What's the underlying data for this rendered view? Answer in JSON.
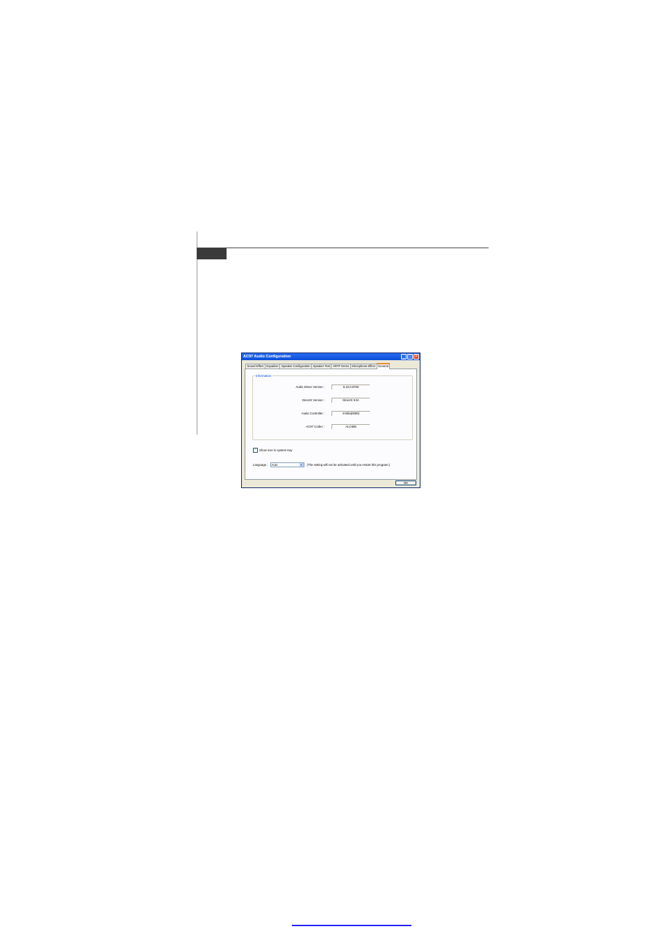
{
  "window": {
    "title": "AC97 Audio Configuration",
    "controls": {
      "minimize": "_",
      "maximize": "□",
      "close": "✕"
    }
  },
  "tabs": [
    {
      "label": "Sound Effect",
      "active": false
    },
    {
      "label": "Equalizer",
      "active": false
    },
    {
      "label": "Speaker Configuration",
      "active": false
    },
    {
      "label": "Speaker Test",
      "active": false
    },
    {
      "label": "HRTF Demo",
      "active": false
    },
    {
      "label": "Microphone Effect",
      "active": false
    },
    {
      "label": "General",
      "active": true
    }
  ],
  "information": {
    "title": "Information",
    "rows": [
      {
        "label": "Audio Driver Version :",
        "value": "5.10.0.5760"
      },
      {
        "label": "DirectX Version :",
        "value": "DirectX 9.0c"
      },
      {
        "label": "Audio Controller :",
        "value": "nVidia(0059)"
      },
      {
        "label": "AC97 Codec :",
        "value": "ALC655"
      }
    ]
  },
  "tray": {
    "label": "Show icon in system tray",
    "checked": true
  },
  "language": {
    "label": "Language :",
    "selected": "Auto",
    "note": "(The setting will not be activated until you restart this program.)"
  },
  "ok_label": "OK",
  "colors": {
    "titlebar": "#0a4ed8",
    "active_tab_accent": "#e68b2c",
    "close_button": "#d8452b",
    "footer_link_line": "#2020ff"
  }
}
